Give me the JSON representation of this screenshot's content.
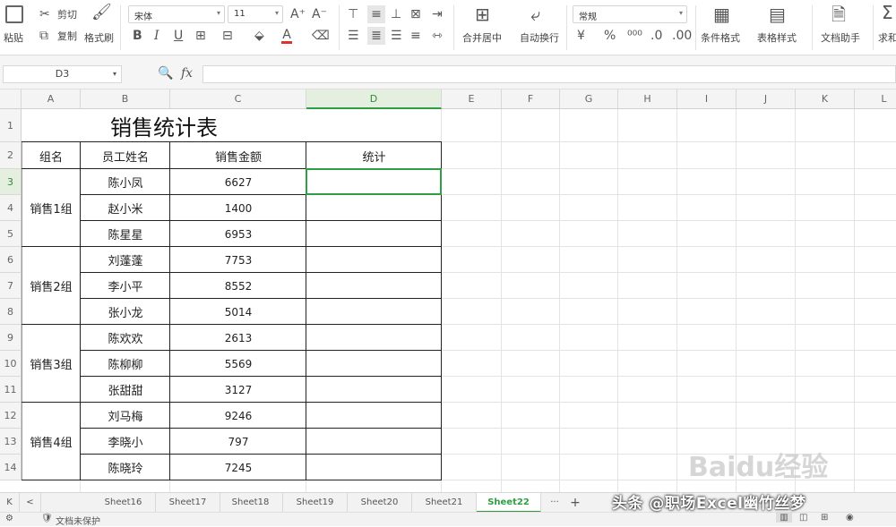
{
  "ribbon": {
    "paste_label": "粘贴",
    "cut_label": "剪切",
    "copy_label": "复制",
    "format_painter_label": "格式刷",
    "font_name": "宋体",
    "font_size": "11",
    "bold": "B",
    "italic": "I",
    "underline": "U",
    "font_color_letter": "A",
    "merge_center_label": "合并居中",
    "wrap_text_label": "自动换行",
    "number_format": "常规",
    "percent": "%",
    "conditional_format_label": "条件格式",
    "table_style_label": "表格样式",
    "doc_assistant_label": "文档助手",
    "sum_label": "求和",
    "sum_icon": "Σ",
    "accent_color": "#2f9e44"
  },
  "formula_bar": {
    "name_box": "D3",
    "fx": "fx",
    "value": ""
  },
  "grid": {
    "columns": [
      "A",
      "B",
      "C",
      "D",
      "E",
      "F",
      "G",
      "H",
      "I",
      "J",
      "K",
      "L"
    ],
    "active_column": "D",
    "rows": [
      "1",
      "2",
      "3",
      "4",
      "5",
      "6",
      "7",
      "8",
      "9",
      "10",
      "11",
      "12",
      "13",
      "14"
    ],
    "active_row": "3",
    "title": "销售统计表",
    "headers": [
      "组名",
      "员工姓名",
      "销售金额",
      "统计"
    ],
    "groups": [
      "销售1组",
      "销售2组",
      "销售3组",
      "销售4组"
    ],
    "names": [
      "陈小凤",
      "赵小米",
      "陈星星",
      "刘蓬蓬",
      "李小平",
      "张小龙",
      "陈欢欢",
      "陈柳柳",
      "张甜甜",
      "刘马梅",
      "李晓小",
      "陈晓玲"
    ],
    "amounts": [
      "6627",
      "1400",
      "6953",
      "7753",
      "8552",
      "5014",
      "2613",
      "5569",
      "3127",
      "9246",
      "797",
      "7245"
    ]
  },
  "sheet_tabs": {
    "nav_first": "K",
    "nav_prev": "<",
    "tabs": [
      "Sheet16",
      "Sheet17",
      "Sheet18",
      "Sheet19",
      "Sheet20",
      "Sheet21",
      "Sheet22"
    ],
    "active_tab": "Sheet22",
    "more": "···",
    "add": "+"
  },
  "status_bar": {
    "doc_status": "文档未保护"
  },
  "overlay": {
    "watermark": "头条 @职场Excel幽竹丝梦",
    "baidu": "Baidu经验"
  }
}
